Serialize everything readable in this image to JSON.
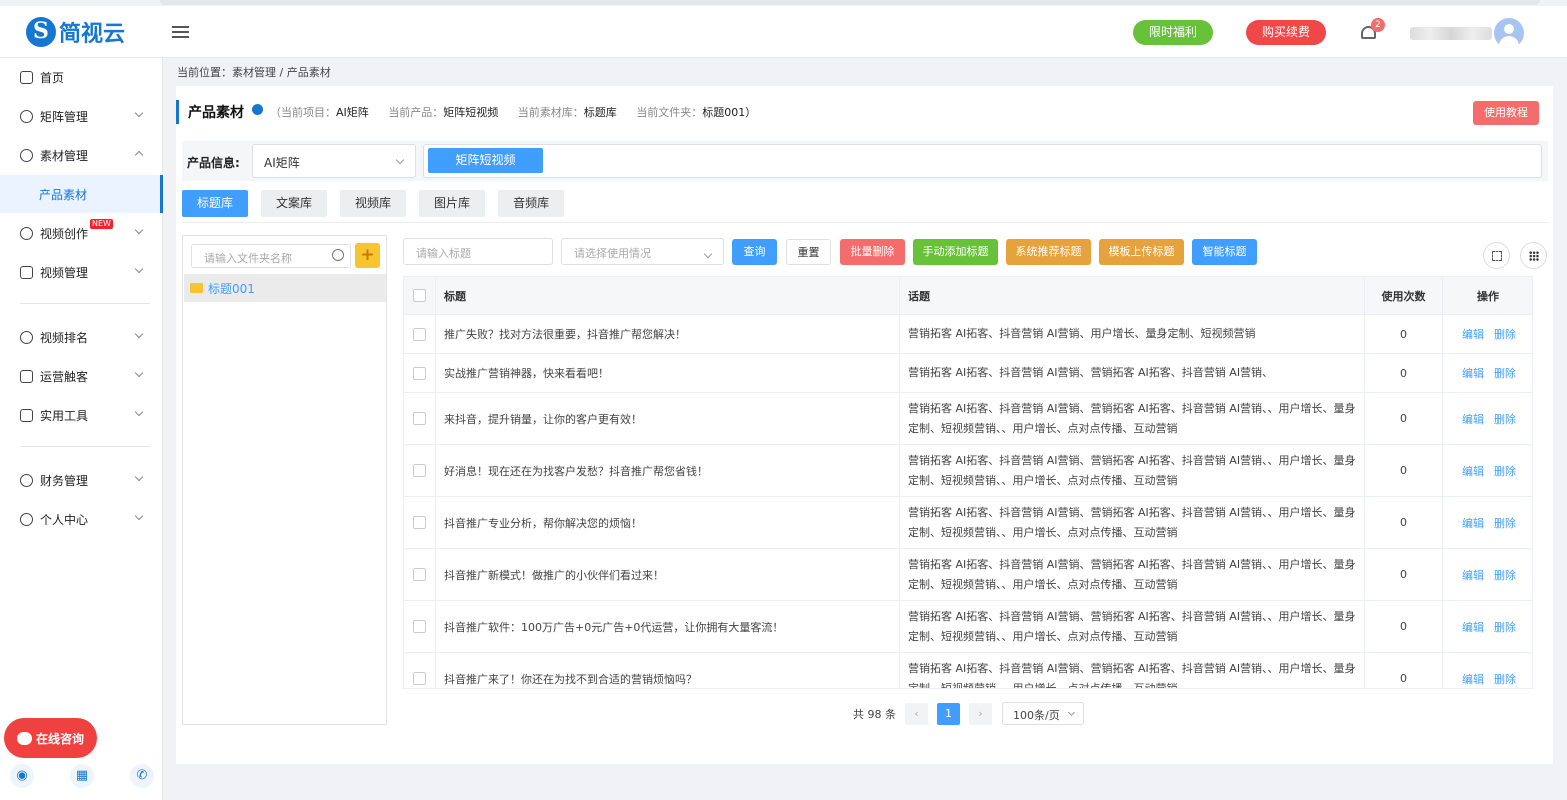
{
  "brand": {
    "name": "简视云"
  },
  "header": {
    "promo_label": "限时福利",
    "buy_label": "购买续费",
    "notif_count": "2"
  },
  "sidebar": {
    "items": [
      {
        "label": "首页"
      },
      {
        "label": "矩阵管理"
      },
      {
        "label": "素材管理"
      },
      {
        "label": "产品素材"
      },
      {
        "label": "视频创作",
        "badge": "NEW"
      },
      {
        "label": "视频管理"
      },
      {
        "label": "视频排名"
      },
      {
        "label": "运营触客"
      },
      {
        "label": "实用工具"
      },
      {
        "label": "财务管理"
      },
      {
        "label": "个人中心"
      }
    ],
    "chat_label": "在线咨询"
  },
  "breadcrumb": "当前位置：素材管理 / 产品素材",
  "page": {
    "title": "产品素材",
    "meta": {
      "project_label": "（当前项目：",
      "project": "AI矩阵",
      "product_label": "当前产品：",
      "product": "矩阵短视频",
      "library_label": "当前素材库：",
      "library": "标题库",
      "folder_label": "当前文件夹：",
      "folder": "标题001）"
    },
    "tutorial_label": "使用教程"
  },
  "product_info": {
    "label": "产品信息:",
    "selected": "AI矩阵",
    "tag": "矩阵短视频"
  },
  "tabs": [
    {
      "label": "标题库"
    },
    {
      "label": "文案库"
    },
    {
      "label": "视频库"
    },
    {
      "label": "图片库"
    },
    {
      "label": "音频库"
    }
  ],
  "tree": {
    "search_placeholder": "请输入文件夹名称",
    "add_icon": "+",
    "node": "标题001"
  },
  "toolbar": {
    "title_placeholder": "请输入标题",
    "usage_placeholder": "请选择使用情况",
    "query": "查询",
    "reset": "重置",
    "batch_delete": "批量删除",
    "manual_add": "手动添加标题",
    "system_recommend": "系统推荐标题",
    "template_upload": "模板上传标题",
    "smart_title": "智能标题",
    "colors": {
      "blue": "#409eff",
      "red": "#f56c6c",
      "green": "#67c23a",
      "orange": "#e6a23c"
    }
  },
  "table": {
    "headers": {
      "title": "标题",
      "topic": "话题",
      "count": "使用次数",
      "action": "操作"
    },
    "rows": [
      {
        "title": "推广失败？找对方法很重要，抖音推广帮您解决！",
        "topic": "营销拓客 AI拓客、抖音营销 AI营销、用户增长、量身定制、短视频营销",
        "count": "0"
      },
      {
        "title": "实战推广营销神器，快来看看吧！",
        "topic": "营销拓客 AI拓客、抖音营销 AI营销、营销拓客 AI拓客、抖音营销 AI营销、",
        "count": "0"
      },
      {
        "title": "来抖音，提升销量，让你的客户更有效！",
        "topic": "营销拓客 AI拓客、抖音营销 AI营销、营销拓客 AI拓客、抖音营销 AI营销、、用户增长、量身定制、短视频营销、、用户增长、点对点传播、互动营销",
        "count": "0"
      },
      {
        "title": "好消息！现在还在为找客户发愁？抖音推广帮您省钱！",
        "topic": "营销拓客 AI拓客、抖音营销 AI营销、营销拓客 AI拓客、抖音营销 AI营销、、用户增长、量身定制、短视频营销、、用户增长、点对点传播、互动营销",
        "count": "0"
      },
      {
        "title": "抖音推广专业分析，帮你解决您的烦恼！",
        "topic": "营销拓客 AI拓客、抖音营销 AI营销、营销拓客 AI拓客、抖音营销 AI营销、、用户增长、量身定制、短视频营销、、用户增长、点对点传播、互动营销",
        "count": "0"
      },
      {
        "title": "抖音推广新模式！做推广的小伙伴们看过来！",
        "topic": "营销拓客 AI拓客、抖音营销 AI营销、营销拓客 AI拓客、抖音营销 AI营销、、用户增长、量身定制、短视频营销、、用户增长、点对点传播、互动营销",
        "count": "0"
      },
      {
        "title": "抖音推广软件：100万广告+0元广告+0代运营，让你拥有大量客流！",
        "topic": "营销拓客 AI拓客、抖音营销 AI营销、营销拓客 AI拓客、抖音营销 AI营销、、用户增长、量身定制、短视频营销、、用户增长、点对点传播、互动营销",
        "count": "0"
      },
      {
        "title": "抖音推广来了！你还在为找不到合适的营销烦恼吗？",
        "topic": "营销拓客 AI拓客、抖音营销 AI营销、营销拓客 AI拓客、抖音营销 AI营销、、用户增长、量身定制、短视频营销、、用户增长、点对点传播、互动营销",
        "count": "0"
      }
    ],
    "edit": "编辑",
    "delete": "删除"
  },
  "pagination": {
    "total": "共 98 条",
    "current": "1",
    "prev": "‹",
    "next": "›",
    "page_size": "100条/页"
  }
}
